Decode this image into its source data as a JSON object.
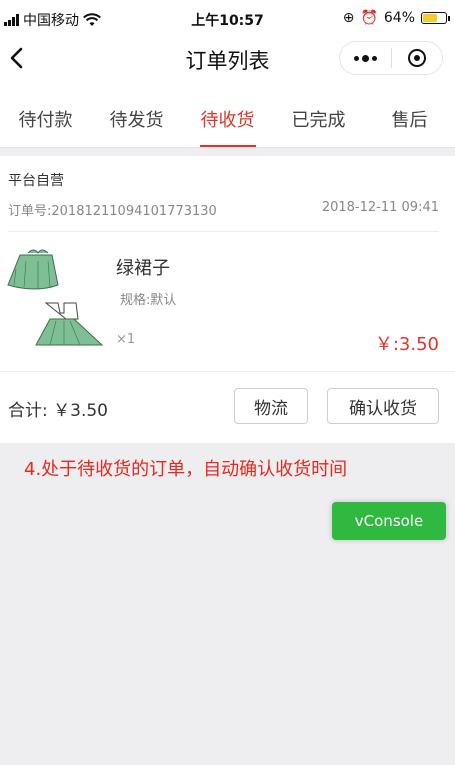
{
  "status_bar": {
    "carrier": "中国移动",
    "time": "上午10:57",
    "battery_percent": "64%",
    "battery_level": 0.64
  },
  "nav": {
    "back_icon": "chevron-left-icon",
    "title": "订单列表"
  },
  "tabs": [
    {
      "label": "待付款",
      "active": false
    },
    {
      "label": "待发货",
      "active": false
    },
    {
      "label": "待收货",
      "active": true
    },
    {
      "label": "已完成",
      "active": false
    },
    {
      "label": "售后",
      "active": false
    }
  ],
  "order": {
    "shop": "平台自营",
    "order_no": "订单号:20181211094101773130",
    "time": "2018-12-11 09:41",
    "product": {
      "name": "绿裙子",
      "spec": "规格:默认",
      "qty": "×1",
      "price": "￥:3.50"
    },
    "total": "合计: ￥3.50",
    "logistics_label": "物流",
    "confirm_label": "确认收货"
  },
  "caption": "4.处于待收货的订单，自动确认收货时间",
  "vconsole_label": "vConsole",
  "colors": {
    "accent_red": "#e0352b",
    "vconsole_green": "#2fb940",
    "dress_green": "#7fbf95"
  }
}
